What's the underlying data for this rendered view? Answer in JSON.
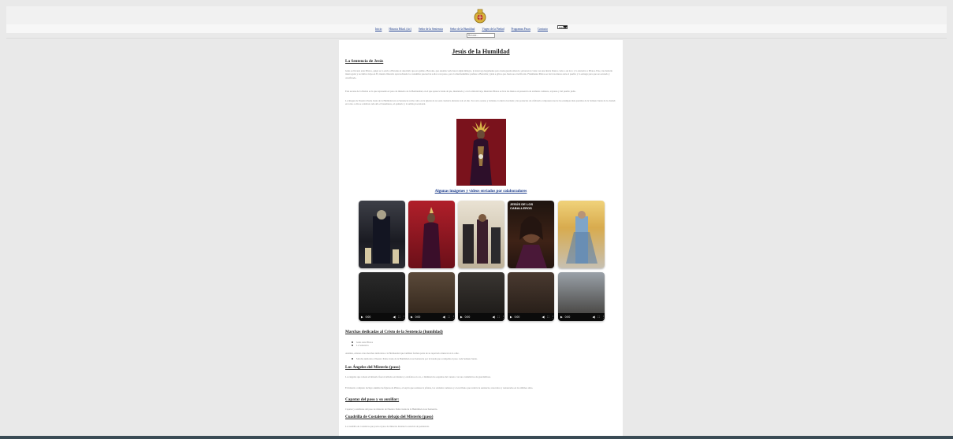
{
  "nav": {
    "links": [
      "Inicio",
      "Historia Hdad. (sic)",
      "Señor de la Sentencia",
      "Señor de la Humildad",
      "Virgen de la Piedad",
      "Programas Pasos",
      "Contacto"
    ],
    "language_label": "Idioma"
  },
  "search": {
    "placeholder": "Buscar..."
  },
  "page": {
    "title": "Jesús de la Humildad",
    "section1_heading": "La Sentencia de Jesús",
    "section1_paragraphs": [
      "Jesús es llevado ante Pilatos, quien se lo envía a Herodes al descubrir que era galileo. Herodes, que ansiaba verle hacer algún milagro, le interroga largamente pero Jesús guarda silencio; entonces le viste con una túnica blanca como a un loco y lo devuelve a Pilatos. Este, tras haberle interrogado y no hallar culpa en Él, intenta liberarlo aprovechando la costumbre pascual de soltar a un preso, pero la muchedumbre prefiere a Barrabás y pide a gritos que Jesús sea crucificado. Finalmente Pilatos se lava las manos ante el pueblo y lo entrega para que sea azotado y crucificado.",
      "Esta escena de la Pasión es la que representa el paso de misterio de la Hermandad, en el que aparece Jesús de pie, maniatado y con la mirada baja, mientras Pilatos se lava las manos en presencia de soldados romanos, sayones y del pueblo judío.",
      "La imagen de Nuestro Padre Jesús de la Humildad en su Sentencia recibe culto en la iglesia de su sede canónica durante todo el año. Su rostro sereno y doliente, la túnica bordada y las potencias de orfebrería componen una de las estampas más queridas de la Semana Santa de la ciudad; en torno a ella se celebran cada año el besamanos, el quinario y la salida procesional."
    ],
    "gallery_title": "Algunas imágenes y vídeos enviados por colaboradores",
    "section2_heading": "Marchas dedicadas al Cristo de la Sentencia (humildad)",
    "section2_items": [
      "Jesús ante Pilatos",
      "La Sentencia"
    ],
    "section2_note": "Además, existen otras marchas dedicadas a la Hermandad que también forman parte de su repertorio musical en la calle.",
    "section2_extra": [
      "Marcha dedicada a Nuestro Padre Jesús de la Humildad en su Sentencia por la banda que acompaña el paso cada Semana Santa."
    ],
    "section3_heading": "Los Ángeles del Misterio (paso)",
    "section3_paragraphs": [
      "Los ángeles que rodean el misterio fueron tallados en madera y estofados en oro, e iluminan las esquinas del canasto con sus candelabros de guardabrisas.",
      "El misterio completo incluye además las figuras de Pilatos, el sayón que sostiene la jofaina, los soldados romanos y el escribano que redacta la sentencia, renovados y restaurados en los últimos años."
    ],
    "section4_heading": "Capataz del paso y su auxiliar:",
    "section4_text": "Capataz y auxiliares del paso de misterio de Nuestro Padre Jesús de la Humildad en su Sentencia.",
    "section5_heading": "Cuadrilla de Costaleros debajo del Misterio (paso)",
    "section5_text": "La cuadrilla de costaleros que porta el paso de misterio durante la estación de penitencia."
  },
  "gallery": {
    "images": [
      {
        "alt": "imagen 1"
      },
      {
        "alt": "imagen 2"
      },
      {
        "alt": "imagen 3"
      },
      {
        "alt": "JESÚS DE LOS CABALLEROS",
        "overlay": "JESÚS DE LOS CABALLEROS"
      },
      {
        "alt": "imagen 5"
      }
    ],
    "videos": [
      {
        "time": "0:00"
      },
      {
        "time": "0:00"
      },
      {
        "time": "0:00"
      },
      {
        "time": "0:00"
      },
      {
        "time": "0:00"
      }
    ]
  },
  "colors": {
    "page_bg": "#e9e9e9",
    "content_bg": "#ffffff",
    "link": "#1a3b8b",
    "hero_red": "#8e1b25",
    "footer": "#3a4b55"
  }
}
